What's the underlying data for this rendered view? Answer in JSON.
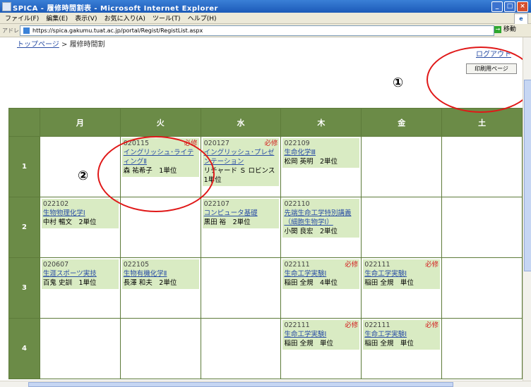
{
  "window": {
    "title": "SPICA - 履修時間割表 - Microsoft Internet Explorer"
  },
  "menu": [
    "ファイル(F)",
    "編集(E)",
    "表示(V)",
    "お気に入り(A)",
    "ツール(T)",
    "ヘルプ(H)"
  ],
  "address": {
    "label": "アドレス(D)",
    "url": "https://spica.gakumu.tuat.ac.jp/portal/Regist/RegistList.aspx",
    "go_label": "移動"
  },
  "breadcrumb": {
    "top_link": "トップページ",
    "separator": " > ",
    "current": "履修時間割"
  },
  "header_links": {
    "logout": "ログアウト",
    "print": "印刷用ページ"
  },
  "annotations": {
    "marker1": "①",
    "marker2": "②",
    "color": "#e01818"
  },
  "timetable": {
    "days": [
      "月",
      "火",
      "水",
      "木",
      "金",
      "土"
    ],
    "periods": [
      {
        "label": "1",
        "cells": [
          null,
          {
            "code": "020115",
            "required": "必修",
            "title": "イングリッシュ･ライティングⅡ",
            "meta": "森 祐希子　1単位"
          },
          {
            "code": "020127",
            "required": "必修",
            "title": "イングリッシュ･プレゼンテーション",
            "meta": "リチャード Ｓ ロビンス　1単位"
          },
          {
            "code": "022109",
            "required": "",
            "title": "生命化学Ⅲ",
            "meta": "松岡 英明　2単位"
          },
          null,
          null
        ]
      },
      {
        "label": "2",
        "cells": [
          {
            "code": "022102",
            "required": "",
            "title": "生物物理化学Ⅰ",
            "meta": "中村 暢文　2単位"
          },
          null,
          {
            "code": "022107",
            "required": "",
            "title": "コンピュータ基礎",
            "meta": "黒田 裕　2単位"
          },
          {
            "code": "022110",
            "required": "",
            "title": "先端生命工学特別講義（細胞生物学Ⅰ）",
            "meta": "小関 良宏　2単位"
          },
          null,
          null
        ]
      },
      {
        "label": "3",
        "cells": [
          {
            "code": "020607",
            "required": "",
            "title": "生涯スポーツ実技",
            "meta": "百鬼 史訓　1単位"
          },
          {
            "code": "022105",
            "required": "",
            "title": "生物有機化学Ⅱ",
            "meta": "長澤 和夫　2単位"
          },
          null,
          {
            "code": "022111",
            "required": "必修",
            "title": "生命工学実験Ⅰ",
            "meta": "稲田 全規　4単位"
          },
          {
            "code": "022111",
            "required": "必修",
            "title": "生命工学実験Ⅰ",
            "meta": "稲田 全規　単位"
          },
          null
        ]
      },
      {
        "label": "4",
        "cells": [
          null,
          null,
          null,
          {
            "code": "022111",
            "required": "必修",
            "title": "生命工学実験Ⅰ",
            "meta": "稲田 全規　単位"
          },
          {
            "code": "022111",
            "required": "必修",
            "title": "生命工学実験Ⅰ",
            "meta": "稲田 全規　単位"
          },
          null
        ]
      }
    ]
  }
}
